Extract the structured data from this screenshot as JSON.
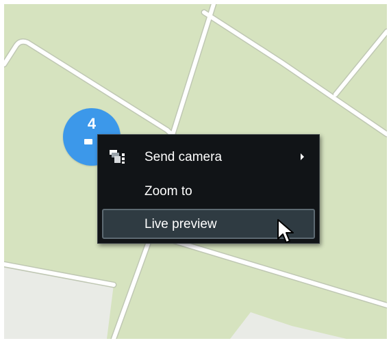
{
  "map": {
    "cluster": {
      "count": "4",
      "icon": "camera-icon",
      "color": "#3c98ea"
    },
    "background_color": "#d6e3bf",
    "road_color": "#ffffff"
  },
  "context_menu": {
    "items": [
      {
        "label": "Send camera",
        "icon": "send-camera-icon",
        "has_submenu": true
      },
      {
        "label": "Zoom to"
      },
      {
        "label": "Live preview",
        "highlighted": true
      }
    ],
    "background_color": "#111417",
    "highlight_color": "#2f3b42"
  },
  "cursor": {
    "icon": "mouse-pointer-icon"
  }
}
